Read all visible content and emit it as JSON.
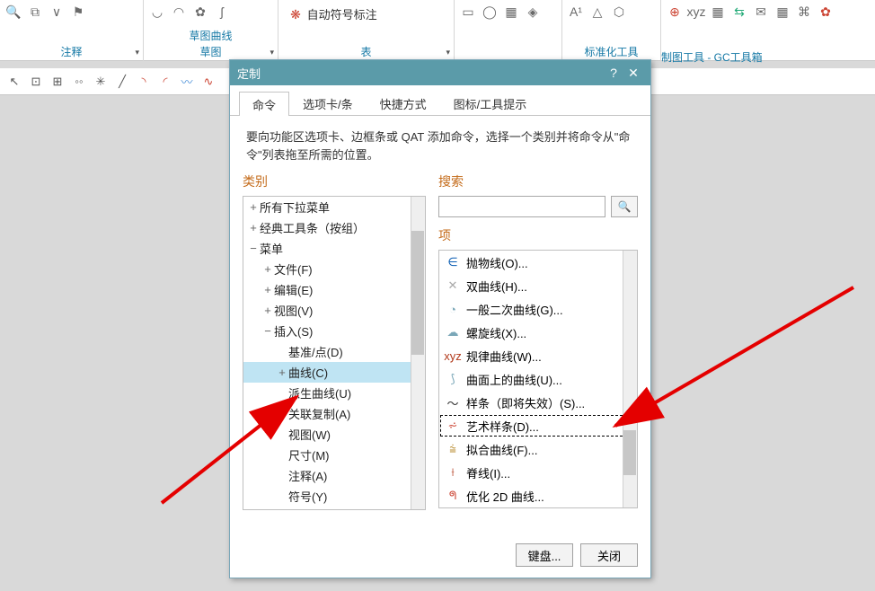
{
  "ribbon": {
    "groups": [
      {
        "label": "注释"
      },
      {
        "label": "草图",
        "sub": "草图曲线"
      },
      {
        "label": "表",
        "item": "自动符号标注"
      },
      {
        "label": ""
      },
      {
        "label": "标准化工具"
      },
      {
        "label": "制图工具 - GC工具箱"
      }
    ]
  },
  "dialog": {
    "title": "定制",
    "help": "?",
    "close": "✕",
    "tabs": [
      "命令",
      "选项卡/条",
      "快捷方式",
      "图标/工具提示"
    ],
    "active_tab": 0,
    "instructions": "要向功能区选项卡、边框条或 QAT 添加命令，选择一个类别并将命令从\"命令\"列表拖至所需的位置。",
    "category_title": "类别",
    "search_title": "搜索",
    "search_placeholder": "",
    "items_title": "项",
    "tree": [
      {
        "indent": 0,
        "exp": "+",
        "label": "所有下拉菜单"
      },
      {
        "indent": 0,
        "exp": "+",
        "label": "经典工具条（按组）"
      },
      {
        "indent": 0,
        "exp": "−",
        "label": "菜单"
      },
      {
        "indent": 1,
        "exp": "+",
        "label": "文件(F)"
      },
      {
        "indent": 1,
        "exp": "+",
        "label": "编辑(E)"
      },
      {
        "indent": 1,
        "exp": "+",
        "label": "视图(V)"
      },
      {
        "indent": 1,
        "exp": "−",
        "label": "插入(S)"
      },
      {
        "indent": 2,
        "exp": "",
        "label": "基准/点(D)"
      },
      {
        "indent": 2,
        "exp": "+",
        "label": "曲线(C)",
        "selected": true
      },
      {
        "indent": 2,
        "exp": "",
        "label": "派生曲线(U)"
      },
      {
        "indent": 2,
        "exp": "",
        "label": "关联复制(A)"
      },
      {
        "indent": 2,
        "exp": "",
        "label": "视图(W)"
      },
      {
        "indent": 2,
        "exp": "",
        "label": "尺寸(M)"
      },
      {
        "indent": 2,
        "exp": "",
        "label": "注释(A)"
      },
      {
        "indent": 2,
        "exp": "",
        "label": "符号(Y)"
      }
    ],
    "items": [
      {
        "icon": "∈",
        "icon_color": "#0a5db3",
        "label": "抛物线(O)..."
      },
      {
        "icon": "✕",
        "icon_color": "#a9a9a9",
        "label": "双曲线(H)..."
      },
      {
        "icon": "◔",
        "icon_color": "#7aa7b8",
        "label": "一般二次曲线(G)..."
      },
      {
        "icon": "☁",
        "icon_color": "#7aa7b8",
        "label": "螺旋线(X)..."
      },
      {
        "icon": "xyz",
        "icon_color": "#b23a1c",
        "label": "规律曲线(W)..."
      },
      {
        "icon": "⟆",
        "icon_color": "#7aa7b8",
        "label": "曲面上的曲线(U)..."
      },
      {
        "icon": "〜",
        "icon_color": "#333",
        "label": "样条（即将失效）(S)..."
      },
      {
        "icon": "⩫",
        "icon_color": "#c43",
        "label": "艺术样条(D)...",
        "highlight": true
      },
      {
        "icon": "⩭",
        "icon_color": "#b78a2b",
        "label": "拟合曲线(F)..."
      },
      {
        "icon": "⟊",
        "icon_color": "#b23a1c",
        "label": "脊线(I)..."
      },
      {
        "icon": "ᖗ",
        "icon_color": "#c43",
        "label": "优化 2D 曲线..."
      }
    ],
    "keyboard_btn": "键盘...",
    "close_btn": "关闭"
  }
}
